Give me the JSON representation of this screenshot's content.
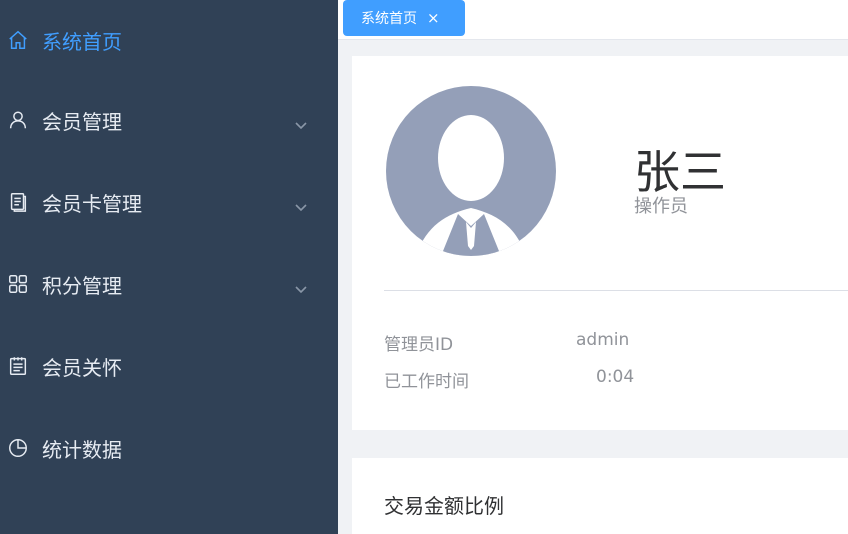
{
  "sidebar": {
    "items": [
      {
        "label": "系统首页",
        "icon": "home-icon",
        "active": true,
        "expandable": false
      },
      {
        "label": "会员管理",
        "icon": "user-icon",
        "active": false,
        "expandable": true
      },
      {
        "label": "会员卡管理",
        "icon": "document-icon",
        "active": false,
        "expandable": true
      },
      {
        "label": "积分管理",
        "icon": "grid-icon",
        "active": false,
        "expandable": true
      },
      {
        "label": "会员关怀",
        "icon": "notes-icon",
        "active": false,
        "expandable": false
      },
      {
        "label": "统计数据",
        "icon": "pie-chart-icon",
        "active": false,
        "expandable": false
      }
    ]
  },
  "tabs": [
    {
      "label": "系统首页",
      "close": "×"
    }
  ],
  "profile": {
    "name": "张三",
    "role": "操作员",
    "fields": [
      {
        "label": "管理员ID",
        "value": "admin"
      },
      {
        "label": "已工作时间",
        "value": "0:04"
      }
    ]
  },
  "chart_card": {
    "title": "交易金额比例"
  },
  "colors": {
    "sidebar_bg": "#304156",
    "accent": "#409eff",
    "avatar_bg": "#949fb8"
  }
}
